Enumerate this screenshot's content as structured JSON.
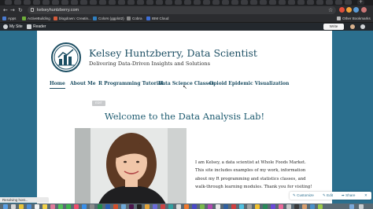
{
  "browser": {
    "url": "kelseyhuntzberry.com",
    "bookmarks": [
      {
        "label": "Apps",
        "color": "#4a7bd0"
      },
      {
        "label": "ActiveBuilding",
        "color": "#6fae3a"
      },
      {
        "label": "blogdown: Creatin...",
        "color": "#d65b3a"
      },
      {
        "label": "Colors (ggplot2)",
        "color": "#2f7fbf"
      },
      {
        "label": "Cobra",
        "color": "#888888"
      },
      {
        "label": "IBM Cloud",
        "color": "#3d6fd8"
      }
    ],
    "other_bookmarks": "Other Bookmarks",
    "status": "Resolving host..."
  },
  "adminbar": {
    "my_site": "My Site",
    "reader": "Reader",
    "write": "Write"
  },
  "site": {
    "title": "Kelsey Huntzberry, Data Scientist",
    "tagline": "Delivering Data-Driven Insights and Solutions",
    "menu": [
      "Home",
      "About Me",
      "R Programming Tutorial",
      "Data Science Classes",
      "Opioid Epidemic Visualization"
    ],
    "active_menu": "Home",
    "edit_label": "EDIT",
    "welcome": "Welcome to the Data Analysis Lab!",
    "intro": "I am Kelsey, a data scientist at Whole Foods Market. This site includes examples of my work, information about my R programming and statistics classes, and walk-through learning modules. Thank you for visiting!"
  },
  "customizer": {
    "customize": "Customize",
    "edit": "Edit",
    "share": "Share"
  },
  "colors": {
    "background": "#2b6f8e",
    "title": "#1c4e63",
    "admin_bar": "#23282d"
  }
}
